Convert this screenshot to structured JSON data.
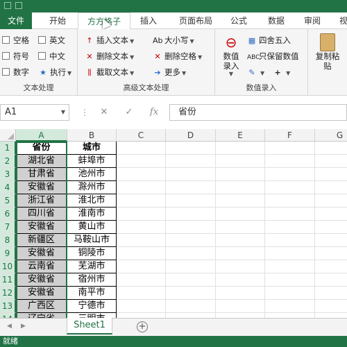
{
  "tabs": [
    {
      "label": "文件",
      "key": "file"
    },
    {
      "label": "开始",
      "key": "home"
    },
    {
      "label": "方方格子",
      "key": "fangfang"
    },
    {
      "label": "插入",
      "key": "insert"
    },
    {
      "label": "页面布局",
      "key": "layout"
    },
    {
      "label": "公式",
      "key": "formulas"
    },
    {
      "label": "数据",
      "key": "data"
    },
    {
      "label": "审阅",
      "key": "review"
    },
    {
      "label": "视",
      "key": "view"
    }
  ],
  "active_tab": "方方格子",
  "ribbon": {
    "text_process": {
      "label": "文本处理",
      "checkboxes": [
        "空格",
        "英文",
        "符号",
        "中文",
        "数字"
      ],
      "execute": "执行"
    },
    "advanced_text": {
      "label": "高级文本处理",
      "insert_text": "插入文本",
      "delete_text": "删除文本",
      "extract_text": "截取文本",
      "case": "大小写",
      "delete_space": "删除空格",
      "more": "更多"
    },
    "number_entry": {
      "label": "数值录入",
      "number_entry_btn": "数值录入",
      "round": "四舍五入",
      "keep_value": "只保留数值"
    },
    "clipboard": {
      "copy_paste": "复制粘贴"
    }
  },
  "formula_bar": {
    "name_box": "A1",
    "fx": "fx",
    "content": "省份"
  },
  "columns": [
    "A",
    "B",
    "C",
    "D",
    "E",
    "F",
    "G"
  ],
  "rows": [
    "1",
    "2",
    "3",
    "4",
    "5",
    "6",
    "7",
    "8",
    "9",
    "10",
    "11",
    "12",
    "13",
    "14"
  ],
  "table": {
    "headers": [
      "省份",
      "城市"
    ],
    "data": [
      [
        "湖北省",
        "蚌埠市"
      ],
      [
        "甘肃省",
        "池州市"
      ],
      [
        "安徽省",
        "滁州市"
      ],
      [
        "浙江省",
        "淮北市"
      ],
      [
        "四川省",
        "淮南市"
      ],
      [
        "安徽省",
        "黄山市"
      ],
      [
        "新疆区",
        "马鞍山市"
      ],
      [
        "安徽省",
        "铜陵市"
      ],
      [
        "云南省",
        "芜湖市"
      ],
      [
        "安徽省",
        "宿州市"
      ],
      [
        "安徽省",
        "南平市"
      ],
      [
        "广西区",
        "宁德市"
      ],
      [
        "辽宁省",
        "三明市"
      ]
    ]
  },
  "sheets": [
    "Sheet1"
  ],
  "status": "就绪",
  "colors": {
    "accent": "#217346",
    "selection": "#d0d0d0"
  }
}
